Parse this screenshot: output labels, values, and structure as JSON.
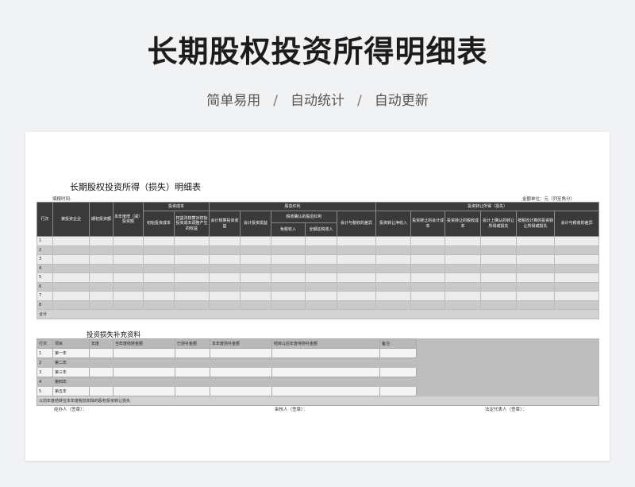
{
  "page": {
    "title": "长期股权投资所得明细表",
    "subtitle": [
      "简单易用",
      "自动统计",
      "自动更新"
    ],
    "separator": "/"
  },
  "sheet": {
    "title": "长期股权投资所得（损失）明细表",
    "fill_time_label": "填报时间:",
    "unit_label": "金额单位：元（列至角分）",
    "headers": {
      "row_no": "行次",
      "investee": "被投资企业",
      "initial_ratio": "期初投资额",
      "year_change": "本年度增（减）投资额",
      "invest_cost": "投资成本",
      "initial_cost": "初始投资成本",
      "equity_adjust": "权益法核算对初始投资成本调整产生的收益",
      "equity_gain_group": "股息红利",
      "acct_equity_gain": "会计核算投资收益",
      "acct_invest_gain": "会计投资损益",
      "tax_confirmed": "税收确认的股息红利",
      "taxable_income": "免税收入",
      "full_taxable": "全额征税收入",
      "acct_tax_diff_1": "会计与税收的差异",
      "transfer_group": "投资转让所得（损失）",
      "transfer_net": "投资转让净收入",
      "transfer_acct_cost": "投资转让的会计成本",
      "transfer_tax_cost": "投资转让的税收成本",
      "acct_confirmed_loss": "会计上确认的转让所得或损失",
      "tax_calc_loss": "按税收计算的投资转让所得或损失",
      "acct_tax_diff_2": "会计与税收的差异"
    },
    "rows": [
      "1",
      "2",
      "3",
      "4",
      "5",
      "6",
      "7",
      "8"
    ],
    "total_label": "合计",
    "supplement": {
      "title": "投资损失补充资料",
      "headers": {
        "row_no": "行次",
        "item": "项目",
        "year": "年度",
        "deductible": "当年度结转金额",
        "compensated": "已弥补金额",
        "current_offset": "本年度弥补金额",
        "carry_forward": "结转以后年度待弥补金额",
        "remark": "备注:"
      },
      "rows": [
        {
          "no": "1",
          "item": "第一年"
        },
        {
          "no": "2",
          "item": "第二年"
        },
        {
          "no": "3",
          "item": "第三年"
        },
        {
          "no": "4",
          "item": "第四年"
        },
        {
          "no": "5",
          "item": "第五年"
        }
      ],
      "footer": "以前年度结转在本年度税前扣除的股权投资转让损失"
    },
    "signatures": {
      "handler": "经办人（签章）：",
      "reviewer": "审核人（签章）：",
      "legal_rep": "法定代表人（签章）："
    }
  }
}
